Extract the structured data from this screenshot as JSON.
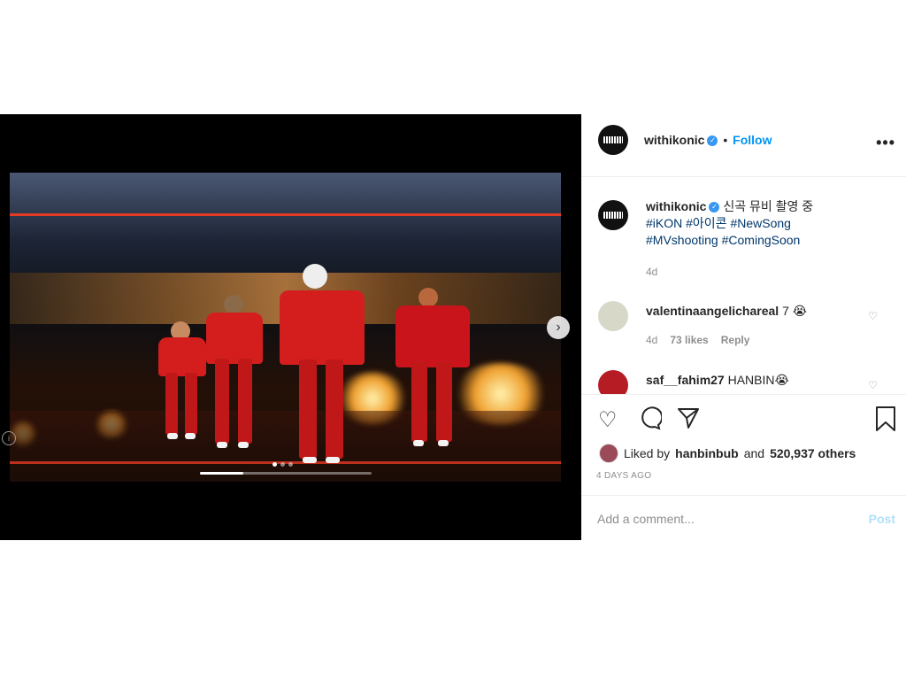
{
  "header": {
    "username": "withikonic",
    "separator": "•",
    "follow_label": "Follow",
    "more_label": "•••"
  },
  "caption": {
    "username": "withikonic",
    "text": "신곡 뮤비 촬영 중",
    "hashtags_line1": [
      "#iKON",
      "#아이콘",
      "#NewSong"
    ],
    "hashtags_line2": [
      "#MVshooting",
      "#ComingSoon"
    ],
    "time": "4d"
  },
  "comments": [
    {
      "username": "valentinaangelichareal",
      "text": "7 😭",
      "time": "4d",
      "likes": "73 likes",
      "reply_label": "Reply"
    },
    {
      "username": "saf__fahim27",
      "text": "HANBIN😭"
    }
  ],
  "actions": {
    "like_icon": "heart-icon",
    "comment_icon": "comment-icon",
    "share_icon": "paper-plane-icon",
    "save_icon": "bookmark-icon"
  },
  "likes": {
    "liked_by_prefix": "Liked by",
    "liked_by_user": "hanbinbub",
    "and_label": "and",
    "others": "520,937 others"
  },
  "timestamp": "4 DAYS AGO",
  "add_comment": {
    "placeholder": "Add a comment...",
    "post_label": "Post"
  },
  "media": {
    "progress": 0.25,
    "slide_count": 3,
    "active_slide": 1,
    "next_icon": "chevron-right-icon"
  },
  "colors": {
    "accent": "#0095f6",
    "verified": "#3897f0",
    "hashtag": "#00376b",
    "muted": "#8e8e8e"
  }
}
